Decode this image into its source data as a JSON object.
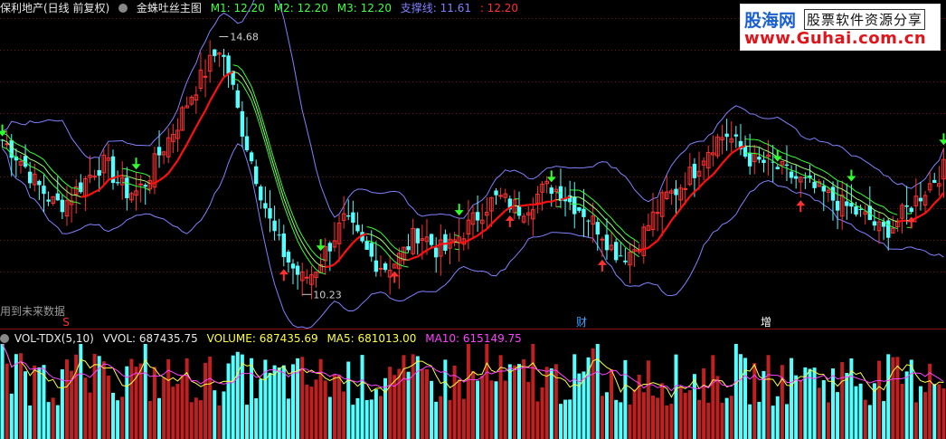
{
  "header": {
    "stock_name": "保利地产(日线 前复权)",
    "indicator_name": "金蛛吐丝主图",
    "m1": "M1: 12.20",
    "m2": "M2: 12.20",
    "m3": "M3: 12.20",
    "support_label": "支撑线: 11.61",
    "support_value": ": 12.20"
  },
  "warning_text": "用到未来数据",
  "logo": {
    "title": "股海网",
    "subtitle": "股票软件资源分享",
    "url": "www.Guhai.com.cn"
  },
  "vol_header": {
    "name": "VOL-TDX(5,10)",
    "vvol": "VVOL: 687435.75",
    "volume": "VOLUME: 687435.69",
    "ma5": "MA5: 681013.00",
    "ma10": "MA10: 615149.75"
  },
  "colors": {
    "up": "#ff3232",
    "down": "#54ffff",
    "band": "#8080ff",
    "line_red": "#ff1010",
    "line_green": "#38ff38",
    "ma5": "#ffff40",
    "ma10": "#ff40ff"
  },
  "chart_data": [
    {
      "type": "candlestick",
      "title": "金蛛吐丝主图",
      "ylim": [
        10.0,
        15.0
      ],
      "high_label": "14.68",
      "low_label": "10.23",
      "markers": [
        {
          "label": "S",
          "color": "#ff3030"
        },
        {
          "label": "财",
          "color": "#40a0ff"
        },
        {
          "label": "增",
          "color": "#ffffff"
        }
      ],
      "price_path": [
        12.9,
        12.7,
        12.5,
        12.2,
        12.0,
        11.8,
        11.8,
        12.0,
        12.2,
        12.4,
        12.5,
        12.2,
        12.0,
        12.0,
        12.2,
        12.6,
        12.9,
        13.2,
        13.6,
        13.9,
        14.2,
        14.5,
        14.0,
        13.2,
        12.6,
        12.0,
        11.4,
        11.0,
        10.7,
        10.5,
        10.6,
        10.9,
        11.2,
        11.5,
        11.3,
        11.0,
        10.8,
        10.7,
        10.8,
        11.0,
        11.3,
        11.2,
        11.0,
        11.0,
        11.2,
        11.4,
        11.6,
        11.8,
        11.9,
        11.8,
        11.7,
        11.8,
        12.0,
        12.1,
        12.0,
        11.8,
        11.7,
        11.5,
        11.3,
        11.0,
        10.9,
        11.0,
        11.3,
        11.6,
        11.9,
        12.0,
        12.2,
        12.4,
        12.7,
        12.9,
        13.0,
        12.8,
        12.6,
        12.5,
        12.5,
        12.4,
        12.3,
        12.2,
        12.1,
        12.0,
        11.9,
        11.8,
        11.7,
        11.6,
        11.5,
        11.3,
        11.4,
        11.6,
        11.8,
        12.0,
        12.2,
        12.4
      ],
      "arrows": [
        {
          "i": 0,
          "dir": "down"
        },
        {
          "i": 13,
          "dir": "down"
        },
        {
          "i": 27,
          "dir": "up"
        },
        {
          "i": 31,
          "dir": "down"
        },
        {
          "i": 38,
          "dir": "up"
        },
        {
          "i": 44,
          "dir": "down"
        },
        {
          "i": 49,
          "dir": "up"
        },
        {
          "i": 53,
          "dir": "down"
        },
        {
          "i": 58,
          "dir": "up"
        },
        {
          "i": 75,
          "dir": "down"
        },
        {
          "i": 77,
          "dir": "up"
        },
        {
          "i": 82,
          "dir": "down"
        },
        {
          "i": 88,
          "dir": "up"
        },
        {
          "i": 91,
          "dir": "down"
        }
      ]
    },
    {
      "type": "bar",
      "title": "VOL-TDX(5,10)",
      "series": [
        {
          "name": "VOLUME",
          "values": []
        },
        {
          "name": "MA5",
          "values": []
        },
        {
          "name": "MA10",
          "values": []
        }
      ]
    }
  ]
}
